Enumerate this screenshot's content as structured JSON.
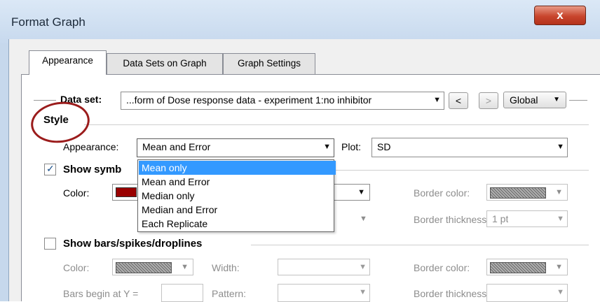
{
  "window": {
    "title": "Format Graph",
    "close_glyph": "x"
  },
  "tabs": [
    "Appearance",
    "Data Sets on Graph",
    "Graph Settings"
  ],
  "dataset": {
    "label": "Data set:",
    "value": "...form of Dose response data - experiment 1:no inhibitor",
    "prev": "<",
    "next": ">",
    "global": "Global"
  },
  "style": {
    "title": "Style",
    "appearance_label": "Appearance:",
    "appearance_value": "Mean and Error",
    "plot_label": "Plot:",
    "plot_value": "SD",
    "options": [
      "Mean only",
      "Mean and Error",
      "Median only",
      "Median and Error",
      "Each Replicate"
    ],
    "selected_option": "Mean only"
  },
  "symbols": {
    "label": "Show symbols",
    "label_visible": "Show symb",
    "checked": true,
    "color_label": "Color:",
    "color": "#990000",
    "border_color_label": "Border color:",
    "border_thickness_label": "Border thickness:",
    "border_thickness_value": "1 pt"
  },
  "bars": {
    "label": "Show bars/spikes/droplines",
    "checked": false,
    "color_label": "Color:",
    "width_label": "Width:",
    "border_color_label": "Border color:",
    "bars_begin_label": "Bars begin at Y =",
    "pattern_label": "Pattern:",
    "border_thickness_label": "Border thickness:"
  },
  "colors": {
    "accent": "#3399ff",
    "annotation": "#9b1c1c",
    "close_button": "#c8452d"
  }
}
